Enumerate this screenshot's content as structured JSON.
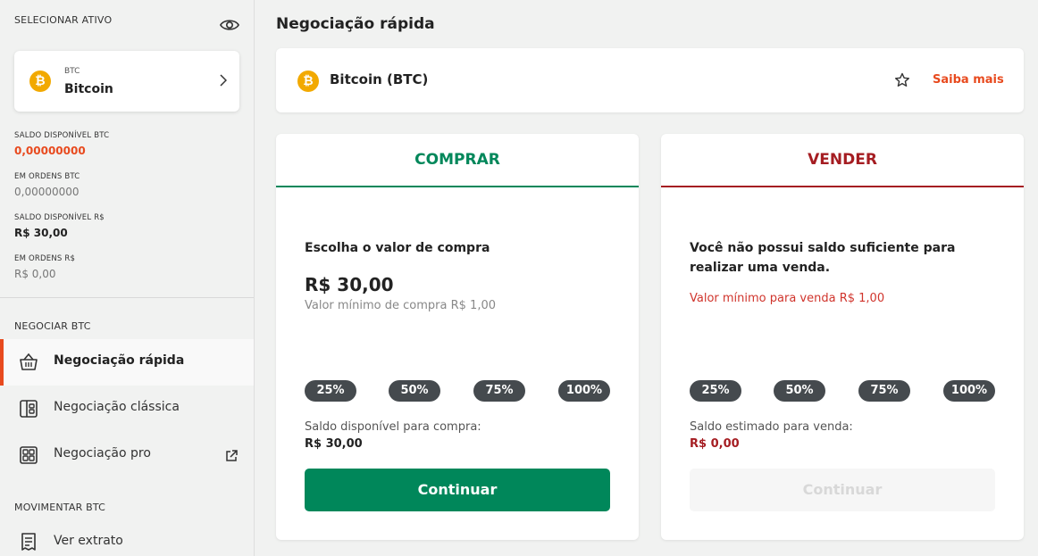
{
  "sidebar": {
    "heading": "SELECIONAR ATIVO",
    "asset": {
      "ticker": "BTC",
      "name": "Bitcoin",
      "coin_symbol": "₿"
    },
    "balances": [
      {
        "label": "SALDO DISPONÍVEL BTC",
        "value": "0,00000000",
        "style": "red"
      },
      {
        "label": "EM ORDENS BTC",
        "value": "0,00000000",
        "style": "muted"
      },
      {
        "label": "SALDO DISPONÍVEL R$",
        "value": "R$ 30,00",
        "style": "dark"
      },
      {
        "label": "EM ORDENS R$",
        "value": "R$ 0,00",
        "style": "muted"
      }
    ],
    "trade_section": "NEGOCIAR BTC",
    "menu": [
      {
        "label": "Negociação rápida",
        "icon": "basket-icon",
        "active": true
      },
      {
        "label": "Negociação clássica",
        "icon": "classic-layout-icon",
        "active": false
      },
      {
        "label": "Negociação pro",
        "icon": "pro-layout-icon",
        "active": false,
        "external": true
      }
    ],
    "move_section": "MOVIMENTAR BTC",
    "move_menu": [
      {
        "label": "Ver extrato",
        "icon": "receipt-icon"
      }
    ]
  },
  "main": {
    "title": "Negociação rápida",
    "asset_header": {
      "name": "Bitcoin (BTC)",
      "coin_symbol": "₿",
      "learn_more": "Saiba mais"
    },
    "buy": {
      "tab": "COMPRAR",
      "heading": "Escolha o valor de compra",
      "amount": "R$  30,00",
      "min_text": "Valor mínimo de compra R$ 1,00",
      "percents": [
        "25%",
        "50%",
        "75%",
        "100%"
      ],
      "avail_label": "Saldo disponível para compra:",
      "avail_value": "R$ 30,00",
      "button": "Continuar"
    },
    "sell": {
      "tab": "VENDER",
      "heading_line1": "Você não possui saldo suficiente para",
      "heading_line2": "realizar uma venda.",
      "min_text": "Valor mínimo para venda R$ 1,00",
      "percents": [
        "25%",
        "50%",
        "75%",
        "100%"
      ],
      "avail_label": "Saldo estimado para venda:",
      "avail_value": "R$ 0,00",
      "button": "Continuar"
    }
  },
  "colors": {
    "accent": "#e84a1e",
    "buy": "#00875a",
    "sell": "#a51d22",
    "bitcoin": "#f2a900"
  }
}
